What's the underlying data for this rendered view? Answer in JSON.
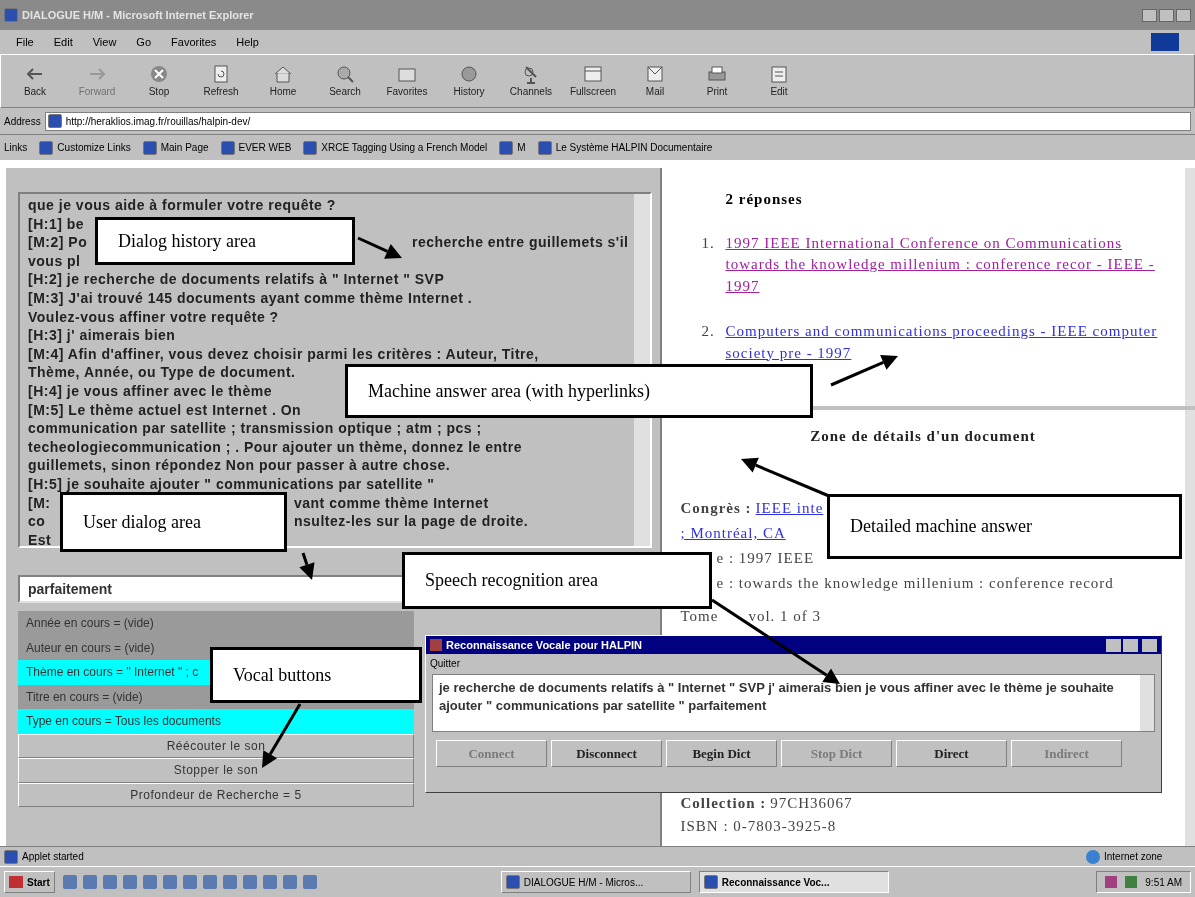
{
  "window": {
    "title": "DIALOGUE H/M - Microsoft Internet Explorer"
  },
  "menu": [
    "File",
    "Edit",
    "View",
    "Go",
    "Favorites",
    "Help"
  ],
  "toolbar": [
    {
      "label": "Back",
      "kind": "back",
      "disabled": false
    },
    {
      "label": "Forward",
      "kind": "forward",
      "disabled": true
    },
    {
      "label": "Stop",
      "kind": "stop",
      "disabled": false
    },
    {
      "label": "Refresh",
      "kind": "refresh",
      "disabled": false
    },
    {
      "label": "Home",
      "kind": "home",
      "disabled": false
    },
    {
      "label": "Search",
      "kind": "search",
      "disabled": false
    },
    {
      "label": "Favorites",
      "kind": "favorites",
      "disabled": false
    },
    {
      "label": "History",
      "kind": "history",
      "disabled": false
    },
    {
      "label": "Channels",
      "kind": "channels",
      "disabled": false
    },
    {
      "label": "Fullscreen",
      "kind": "fullscreen",
      "disabled": false
    },
    {
      "label": "Mail",
      "kind": "mail",
      "disabled": false
    },
    {
      "label": "Print",
      "kind": "print",
      "disabled": false
    },
    {
      "label": "Edit",
      "kind": "edit",
      "disabled": false
    }
  ],
  "address": {
    "label": "Address",
    "value": "http://heraklios.imag.fr/rouillas/halpin-dev/"
  },
  "links": {
    "label": "Links",
    "items": [
      "Customize Links",
      "Main Page",
      "EVER WEB",
      "XRCE Tagging Using a French Model",
      "M",
      "Le Système HALPIN Documentaire"
    ]
  },
  "dialog_history": [
    {
      "parts": [
        "que je vous aide à formuler votre requête ?"
      ]
    },
    {
      "parts": [
        "[H:1] be"
      ]
    },
    {
      "parts": [
        "[M:2] Po",
        "recherche entre guillemets s'il"
      ]
    },
    {
      "parts": [
        "vous pl"
      ]
    },
    {
      "parts": [
        "[H:2]  je recherche de documents relatifs à \" Internet \" SVP"
      ]
    },
    {
      "parts": [
        "[M:3] J'ai trouvé 145 documents  ayant comme thème   Internet  ."
      ]
    },
    {
      "parts": [
        "Voulez-vous affiner votre requête ?"
      ]
    },
    {
      "parts": [
        "[H:3]  j' aimerais bien"
      ]
    },
    {
      "parts": [
        "[M:4] Afin d'affiner, vous devez choisir parmi les critères : Auteur, Titre,"
      ]
    },
    {
      "parts": [
        "Thème, Année, ou Type de document."
      ]
    },
    {
      "parts": [
        "[H:4]  je vous affiner avec le thème"
      ]
    },
    {
      "parts": [
        "[M:5] Le thème actuel est   Internet  . On"
      ]
    },
    {
      "parts": [
        "communication par satellite ; transmission optique ; atm ; pcs ;"
      ]
    },
    {
      "parts": [
        "techeologiecommunication ; . Pour ajouter un thème, donnez le entre"
      ]
    },
    {
      "parts": [
        "guillemets, sinon répondez Non pour passer à autre chose."
      ]
    },
    {
      "parts": [
        "[H:5] je souhaite ajouter \" communications par satellite \""
      ]
    },
    {
      "parts": [
        "[M:",
        "vant comme thème   Internet"
      ]
    },
    {
      "parts": [
        "co",
        "nsultez-les sur la page de droite."
      ]
    },
    {
      "parts": [
        "Est"
      ]
    }
  ],
  "user_input": {
    "value": "parfaitement"
  },
  "vocal_buttons": [
    {
      "label": "Année en cours = (vide)",
      "active": false
    },
    {
      "label": "Auteur en cours = (vide)",
      "active": false
    },
    {
      "label": "Thème en cours = \" Internet \" ; c",
      "active": true
    },
    {
      "label": "Titre en cours = (vide)",
      "active": false
    },
    {
      "label": "Type en cours = Tous les documents",
      "active": true
    }
  ],
  "sound_buttons": [
    "Réécouter le son",
    "Stopper le son",
    "Profondeur de Recherche = 5"
  ],
  "answers": {
    "heading": "2 réponses",
    "items": [
      {
        "number": "1.",
        "text": "1997 IEEE International Conference on Communications towards the knowledge millenium : conference recor - IEEE - 1997",
        "visited": true
      },
      {
        "number": "2.",
        "text": "Computers and communications proceedings - IEEE computer society pre - 1997",
        "visited": false
      }
    ]
  },
  "details": {
    "heading": "Zone de détails d'un document",
    "congres_label": "Congrès :",
    "congres_link": "IEEE inte",
    "congres_link_2": "; Montréal, CA",
    "title_line": "e : 1997 IEEE",
    "title_line_2": "e : towards the knowledge millenium : conference record",
    "tome_label": "Tome",
    "tome": "vol. 1 of 3",
    "collection_label": "Collection :",
    "collection": "97CH36067",
    "isbn": "ISBN : 0-7803-3925-8"
  },
  "speech_window": {
    "title": "Reconnaissance Vocale pour HALPIN",
    "menu": "Quitter",
    "text": "je recherche de documents relatifs à \" Internet \" SVP j' aimerais bien je vous affiner avec le thème je souhaite ajouter \" communications par satellite \" parfaitement",
    "buttons": [
      {
        "label": "Connect",
        "disabled": true
      },
      {
        "label": "Disconnect",
        "disabled": false
      },
      {
        "label": "Begin Dict",
        "disabled": false
      },
      {
        "label": "Stop Dict",
        "disabled": true
      },
      {
        "label": "Direct",
        "disabled": false
      },
      {
        "label": "Indirect",
        "disabled": true
      }
    ]
  },
  "status_bar": {
    "text": "Applet started",
    "zone": "Internet zone"
  },
  "taskbar": {
    "start": "Start",
    "tasks": [
      {
        "label": "DIALOGUE H/M - Micros...",
        "selected": false
      },
      {
        "label": "Reconnaissance Voc...",
        "selected": true
      }
    ],
    "clock": "9:51 AM"
  },
  "annotations": [
    "Dialog history area",
    "Machine answer area (with hyperlinks)",
    "User dialog area",
    "Detailed machine answer",
    "Speech recognition area",
    "Vocal buttons"
  ]
}
